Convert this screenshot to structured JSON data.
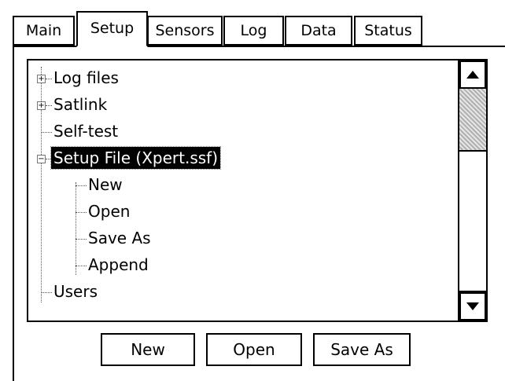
{
  "tabs": [
    {
      "label": "Main",
      "active": false
    },
    {
      "label": "Setup",
      "active": true
    },
    {
      "label": "Sensors",
      "active": false
    },
    {
      "label": "Log",
      "active": false
    },
    {
      "label": "Data",
      "active": false
    },
    {
      "label": "Status",
      "active": false
    }
  ],
  "tree": {
    "items": [
      {
        "label": "Log files",
        "level": 0,
        "expander": "+",
        "selected": false
      },
      {
        "label": "Satlink",
        "level": 0,
        "expander": "+",
        "selected": false
      },
      {
        "label": "Self-test",
        "level": 0,
        "expander": "",
        "selected": false
      },
      {
        "label": "Setup File (Xpert.ssf)",
        "level": 0,
        "expander": "-",
        "selected": true
      },
      {
        "label": "New",
        "level": 1,
        "expander": "",
        "selected": false
      },
      {
        "label": "Open",
        "level": 1,
        "expander": "",
        "selected": false
      },
      {
        "label": "Save As",
        "level": 1,
        "expander": "",
        "selected": false
      },
      {
        "label": "Append",
        "level": 1,
        "expander": "",
        "selected": false
      },
      {
        "label": "Users",
        "level": 0,
        "expander": "",
        "selected": false
      }
    ]
  },
  "scrollbar": {
    "up_icon": "triangle-up",
    "down_icon": "triangle-down"
  },
  "buttons": {
    "new_label": "New",
    "open_label": "Open",
    "save_as_label": "Save As"
  }
}
